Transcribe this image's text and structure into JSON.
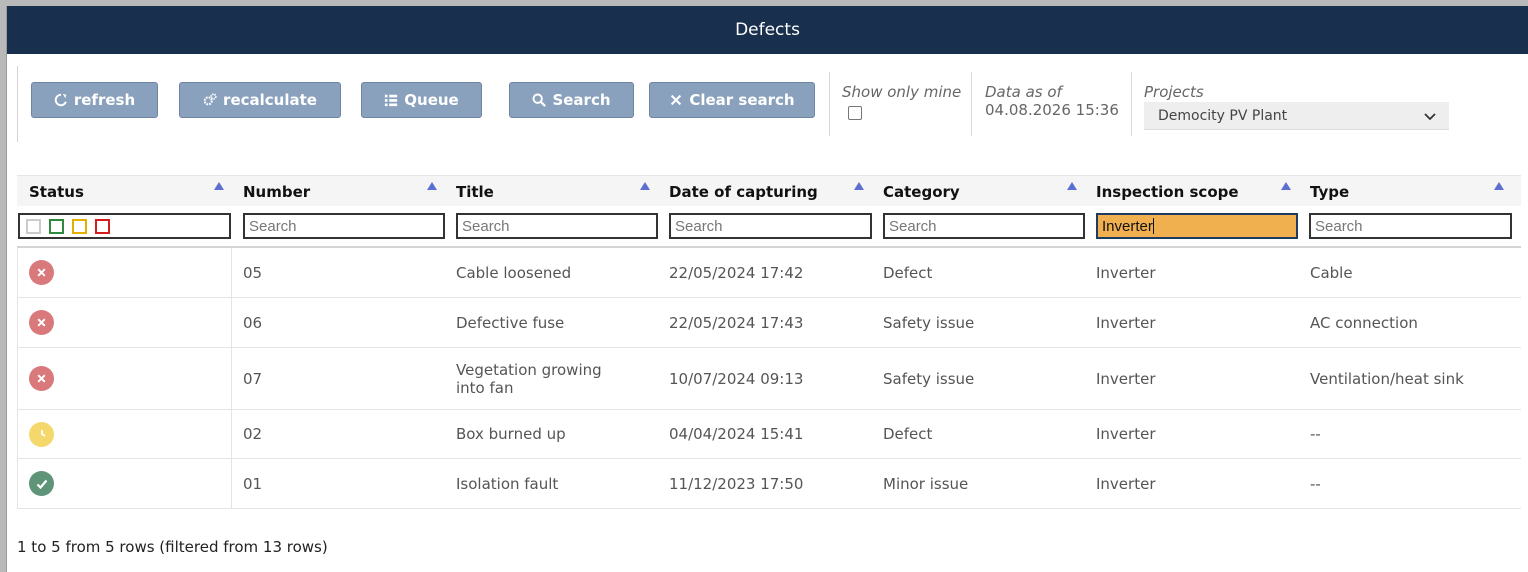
{
  "window": {
    "title": "Defects"
  },
  "toolbar": {
    "refresh_label": "refresh",
    "recalculate_label": "recalculate",
    "queue_label": "Queue",
    "search_label": "Search",
    "clear_search_label": "Clear search",
    "show_only_mine_label": "Show only mine",
    "show_only_mine_checked": false,
    "data_as_of_label": "Data as of",
    "data_as_of_value": "04.08.2026 15:36",
    "projects_label": "Projects",
    "projects_selected": "Democity PV Plant"
  },
  "columns": [
    "Status",
    "Number",
    "Title",
    "Date of capturing",
    "Category",
    "Inspection scope",
    "Type"
  ],
  "filters": {
    "placeholder": "Search",
    "number": "",
    "title": "",
    "date": "",
    "category": "",
    "inspection_scope": "Inverter",
    "type": "",
    "status_colors": [
      "#cccccc",
      "#2e8b3d",
      "#e3b000",
      "#d41c1c"
    ]
  },
  "rows": [
    {
      "status": "error",
      "number": "05",
      "title": "Cable loosened",
      "date": "22/05/2024 17:42",
      "category": "Defect",
      "scope": "Inverter",
      "type": "Cable"
    },
    {
      "status": "error",
      "number": "06",
      "title": "Defective fuse",
      "date": "22/05/2024 17:43",
      "category": "Safety issue",
      "scope": "Inverter",
      "type": "AC connection"
    },
    {
      "status": "error",
      "number": "07",
      "title": "Vegetation growing into fan",
      "date": "10/07/2024 09:13",
      "category": "Safety issue",
      "scope": "Inverter",
      "type": "Ventilation/heat sink"
    },
    {
      "status": "pending",
      "number": "02",
      "title": "Box burned up",
      "date": "04/04/2024 15:41",
      "category": "Defect",
      "scope": "Inverter",
      "type": "--"
    },
    {
      "status": "done",
      "number": "01",
      "title": "Isolation fault",
      "date": "11/12/2023 17:50",
      "category": "Minor issue",
      "scope": "Inverter",
      "type": "--"
    }
  ],
  "footer": {
    "summary": "1 to 5 from 5 rows (filtered from 13 rows)"
  },
  "colors": {
    "header": "#182f4d",
    "button": "#8aa1bd",
    "error": "#d9797b",
    "pending": "#f5d86b",
    "done": "#5f9478",
    "active_filter": "#f0b050"
  }
}
